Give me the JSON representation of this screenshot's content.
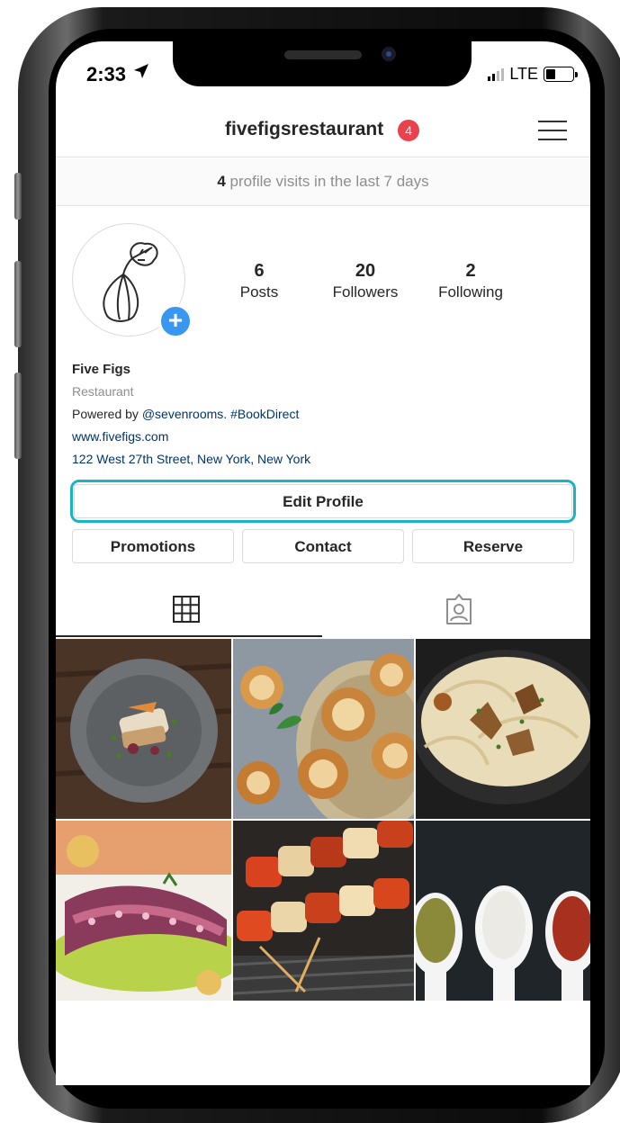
{
  "status_bar": {
    "time": "2:33",
    "network": "LTE"
  },
  "header": {
    "username": "fivefigsrestaurant",
    "notification_count": "4"
  },
  "visits": {
    "count": "4",
    "text": " profile visits in the last 7 days"
  },
  "stats": [
    {
      "num": "6",
      "label": "Posts"
    },
    {
      "num": "20",
      "label": "Followers"
    },
    {
      "num": "2",
      "label": "Following"
    }
  ],
  "bio": {
    "name": "Five Figs",
    "category": "Restaurant",
    "powered_prefix": "Powered by ",
    "powered_link": "@sevenrooms. #BookDirect",
    "website": "www.fivefigs.com",
    "address": "122 West 27th Street, New York, New York"
  },
  "buttons": {
    "edit_profile": "Edit Profile",
    "promotions": "Promotions",
    "contact": "Contact",
    "reserve": "Reserve"
  },
  "colors": {
    "accent": "#1bb3bf",
    "badge": "#e8424f",
    "link": "#003569",
    "plus": "#3897f0"
  },
  "icons": [
    "location-arrow-icon",
    "signal-icon",
    "battery-icon",
    "menu-icon",
    "plus-icon",
    "grid-icon",
    "tagged-icon",
    "fig-logo-icon"
  ]
}
